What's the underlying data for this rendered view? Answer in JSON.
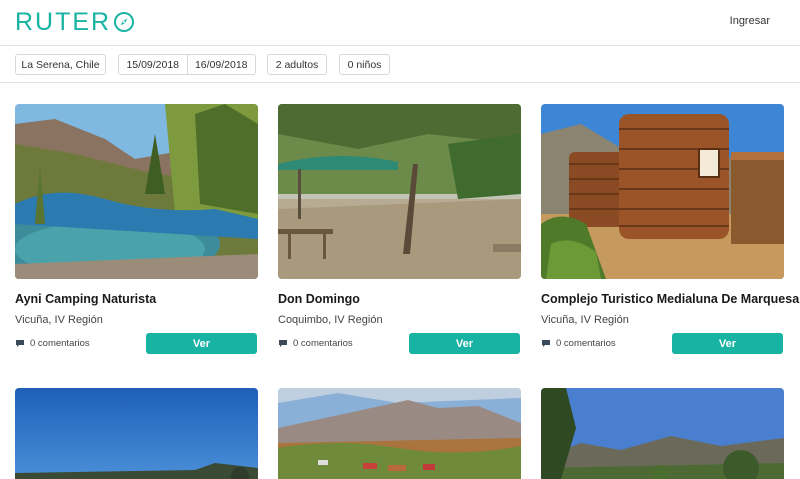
{
  "header": {
    "logo_text": "RUTER",
    "login_label": "Ingresar"
  },
  "filters": {
    "location": "La Serena, Chile",
    "date_from": "15/09/2018",
    "date_to": "16/09/2018",
    "adults": "2 adultos",
    "kids": "0 niños"
  },
  "listings": [
    {
      "title": "Ayni Camping Naturista",
      "location": "Vicuña, IV Región",
      "comments": "0 comentarios",
      "button": "Ver"
    },
    {
      "title": "Don Domingo",
      "location": "Coquimbo, IV Región",
      "comments": "0 comentarios",
      "button": "Ver"
    },
    {
      "title": "Complejo Turistico Medialuna De Marquesa",
      "location": "Vicuña, IV Región",
      "comments": "0 comentarios",
      "button": "Ver"
    }
  ],
  "colors": {
    "accent": "#19b3a3",
    "border": "#d8d8d8"
  },
  "icons": {
    "logo": "compass-icon",
    "comments": "speech-bubble-icon"
  }
}
